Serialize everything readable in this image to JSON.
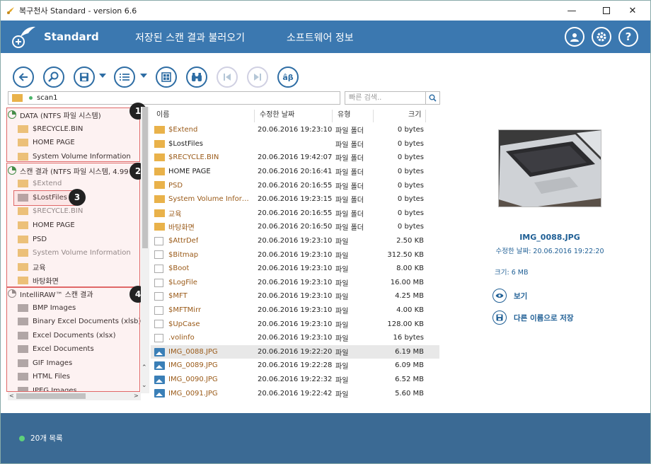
{
  "window": {
    "title": "복구천사 Standard - version 6.6",
    "controls": [
      "minimize",
      "maximize",
      "close"
    ]
  },
  "header": {
    "brand": "Standard",
    "menu": [
      "저장된 스캔 결과 불러오기",
      "소프트웨어 정보"
    ],
    "buttons": [
      "user-icon",
      "gear-icon",
      "help-icon"
    ]
  },
  "toolbar": {
    "icons": [
      "back-icon",
      "search-icon",
      "save-icon",
      "list-icon",
      "grid-icon",
      "binoculars-icon",
      "previous-icon",
      "next-icon",
      "text-icon"
    ]
  },
  "path": {
    "value": "scan1",
    "search_placeholder": "빠른 검색.."
  },
  "tree": {
    "disk1": {
      "label": "DATA (NTFS 파일 시스템)",
      "items": [
        "$RECYCLE.BIN",
        "HOME PAGE",
        "System Volume Information"
      ]
    },
    "disk2": {
      "label": "스캔 결과 (NTFS 파일 시스템, 4.99",
      "items": [
        "$Extend",
        "$LostFiles",
        "$RECYCLE.BIN",
        "HOME PAGE",
        "PSD",
        "System Volume Information",
        "교육",
        "바탕화면"
      ]
    },
    "disk3": {
      "label": "IntelliRAW™ 스캔 결과",
      "items": [
        "BMP Images",
        "Binary Excel Documents (xlsb)",
        "Excel Documents (xlsx)",
        "Excel Documents",
        "GIF Images",
        "HTML Files",
        "JPEG Images"
      ]
    }
  },
  "badges": [
    "1",
    "2",
    "3",
    "4"
  ],
  "columns": {
    "name": "이름",
    "date": "수정한 날짜",
    "type": "유형",
    "size": "크기"
  },
  "files": [
    {
      "name": "$Extend",
      "date": "20.06.2016 19:23:10",
      "type": "파일 폴더",
      "size": "0 bytes",
      "kind": "folder",
      "color": "orange"
    },
    {
      "name": "$LostFiles",
      "date": "",
      "type": "파일 폴더",
      "size": "0 bytes",
      "kind": "folder",
      "color": "black"
    },
    {
      "name": "$RECYCLE.BIN",
      "date": "20.06.2016 19:42:07",
      "type": "파일 폴더",
      "size": "0 bytes",
      "kind": "folder",
      "color": "orange"
    },
    {
      "name": "HOME PAGE",
      "date": "20.06.2016 20:16:41",
      "type": "파일 폴더",
      "size": "0 bytes",
      "kind": "folder",
      "color": "black"
    },
    {
      "name": "PSD",
      "date": "20.06.2016 20:16:55",
      "type": "파일 폴더",
      "size": "0 bytes",
      "kind": "folder",
      "color": "orange"
    },
    {
      "name": "System Volume Informati...",
      "date": "20.06.2016 19:23:15",
      "type": "파일 폴더",
      "size": "0 bytes",
      "kind": "folder",
      "color": "orange"
    },
    {
      "name": "교육",
      "date": "20.06.2016 20:16:55",
      "type": "파일 폴더",
      "size": "0 bytes",
      "kind": "folder",
      "color": "orange"
    },
    {
      "name": "바탕화면",
      "date": "20.06.2016 20:16:50",
      "type": "파일 폴더",
      "size": "0 bytes",
      "kind": "folder",
      "color": "orange"
    },
    {
      "name": "$AttrDef",
      "date": "20.06.2016 19:23:10",
      "type": "파일",
      "size": "2.50 KB",
      "kind": "file",
      "color": "orange"
    },
    {
      "name": "$Bitmap",
      "date": "20.06.2016 19:23:10",
      "type": "파일",
      "size": "312.50 KB",
      "kind": "file",
      "color": "orange"
    },
    {
      "name": "$Boot",
      "date": "20.06.2016 19:23:10",
      "type": "파일",
      "size": "8.00 KB",
      "kind": "file",
      "color": "orange"
    },
    {
      "name": "$LogFile",
      "date": "20.06.2016 19:23:10",
      "type": "파일",
      "size": "16.00 MB",
      "kind": "file",
      "color": "orange"
    },
    {
      "name": "$MFT",
      "date": "20.06.2016 19:23:10",
      "type": "파일",
      "size": "4.25 MB",
      "kind": "file",
      "color": "orange"
    },
    {
      "name": "$MFTMirr",
      "date": "20.06.2016 19:23:10",
      "type": "파일",
      "size": "4.00 KB",
      "kind": "file",
      "color": "orange"
    },
    {
      "name": "$UpCase",
      "date": "20.06.2016 19:23:10",
      "type": "파일",
      "size": "128.00 KB",
      "kind": "file",
      "color": "orange"
    },
    {
      "name": ".volinfo",
      "date": "20.06.2016 19:23:10",
      "type": "파일",
      "size": "16 bytes",
      "kind": "file",
      "color": "orange"
    },
    {
      "name": "IMG_0088.JPG",
      "date": "20.06.2016 19:22:20",
      "type": "파일",
      "size": "6.19 MB",
      "kind": "image",
      "color": "orange",
      "selected": true
    },
    {
      "name": "IMG_0089.JPG",
      "date": "20.06.2016 19:22:28",
      "type": "파일",
      "size": "6.09 MB",
      "kind": "image",
      "color": "orange"
    },
    {
      "name": "IMG_0090.JPG",
      "date": "20.06.2016 19:22:32",
      "type": "파일",
      "size": "6.52 MB",
      "kind": "image",
      "color": "orange"
    },
    {
      "name": "IMG_0091.JPG",
      "date": "20.06.2016 19:22:42",
      "type": "파일",
      "size": "5.60 MB",
      "kind": "image",
      "color": "orange"
    }
  ],
  "preview": {
    "name": "IMG_0088.JPG",
    "date": "수정한 날짜: 20.06.2016 19:22:20",
    "size": "크기: 6 MB",
    "view_label": "보기",
    "save_as_label": "다른 이름으로 저장"
  },
  "status": {
    "text": "20개 목록"
  }
}
